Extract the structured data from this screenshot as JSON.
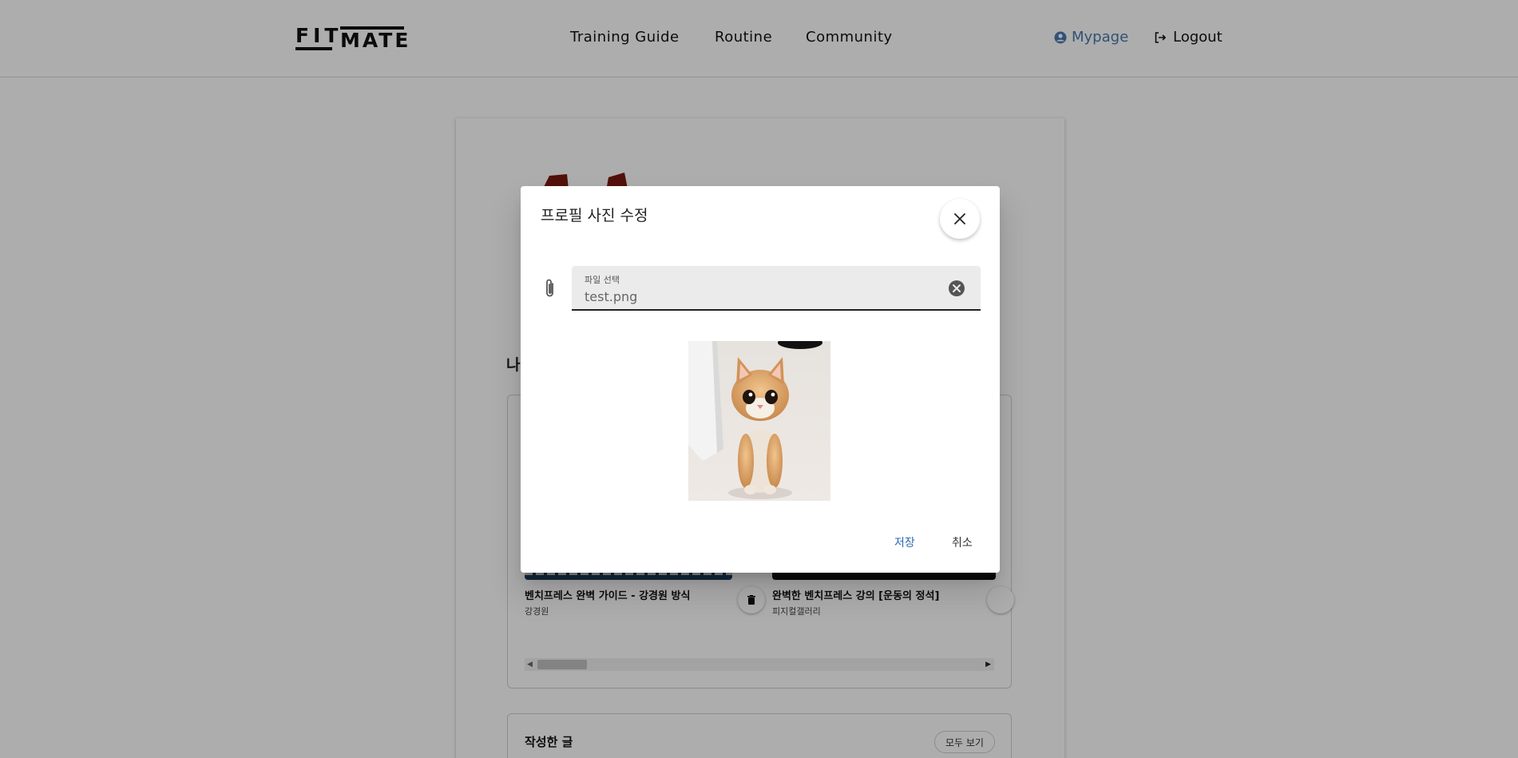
{
  "header": {
    "logo": {
      "part1": "FIT",
      "part2": "MATE"
    },
    "nav": [
      "Training Guide",
      "Routine",
      "Community"
    ],
    "mypage_label": "Mypage",
    "logout_label": "Logout"
  },
  "profile_card": {
    "section_title_fragment": "나",
    "videos": [
      {
        "title": "벤치프레스 완벽 가이드 - 강경원 방식",
        "author": "강경원"
      },
      {
        "title": "완벽한 벤치프레스 강의 [운동의 정석]",
        "author": "피지컬갤러리"
      }
    ],
    "posts_title": "작성한 글",
    "view_all_label": "모두 보기"
  },
  "dialog": {
    "title": "프로필 사진 수정",
    "file_field": {
      "label": "파일 선택",
      "value": "test.png"
    },
    "save_label": "저장",
    "cancel_label": "취소"
  },
  "colors": {
    "accent": "#4a78b0",
    "save_text": "#2e6bb0",
    "overlay": "rgba(0,0,0,0.32)"
  },
  "icons": [
    "user-circle-icon",
    "logout-icon",
    "close-icon",
    "paperclip-icon",
    "clear-circle-icon",
    "trash-icon"
  ]
}
